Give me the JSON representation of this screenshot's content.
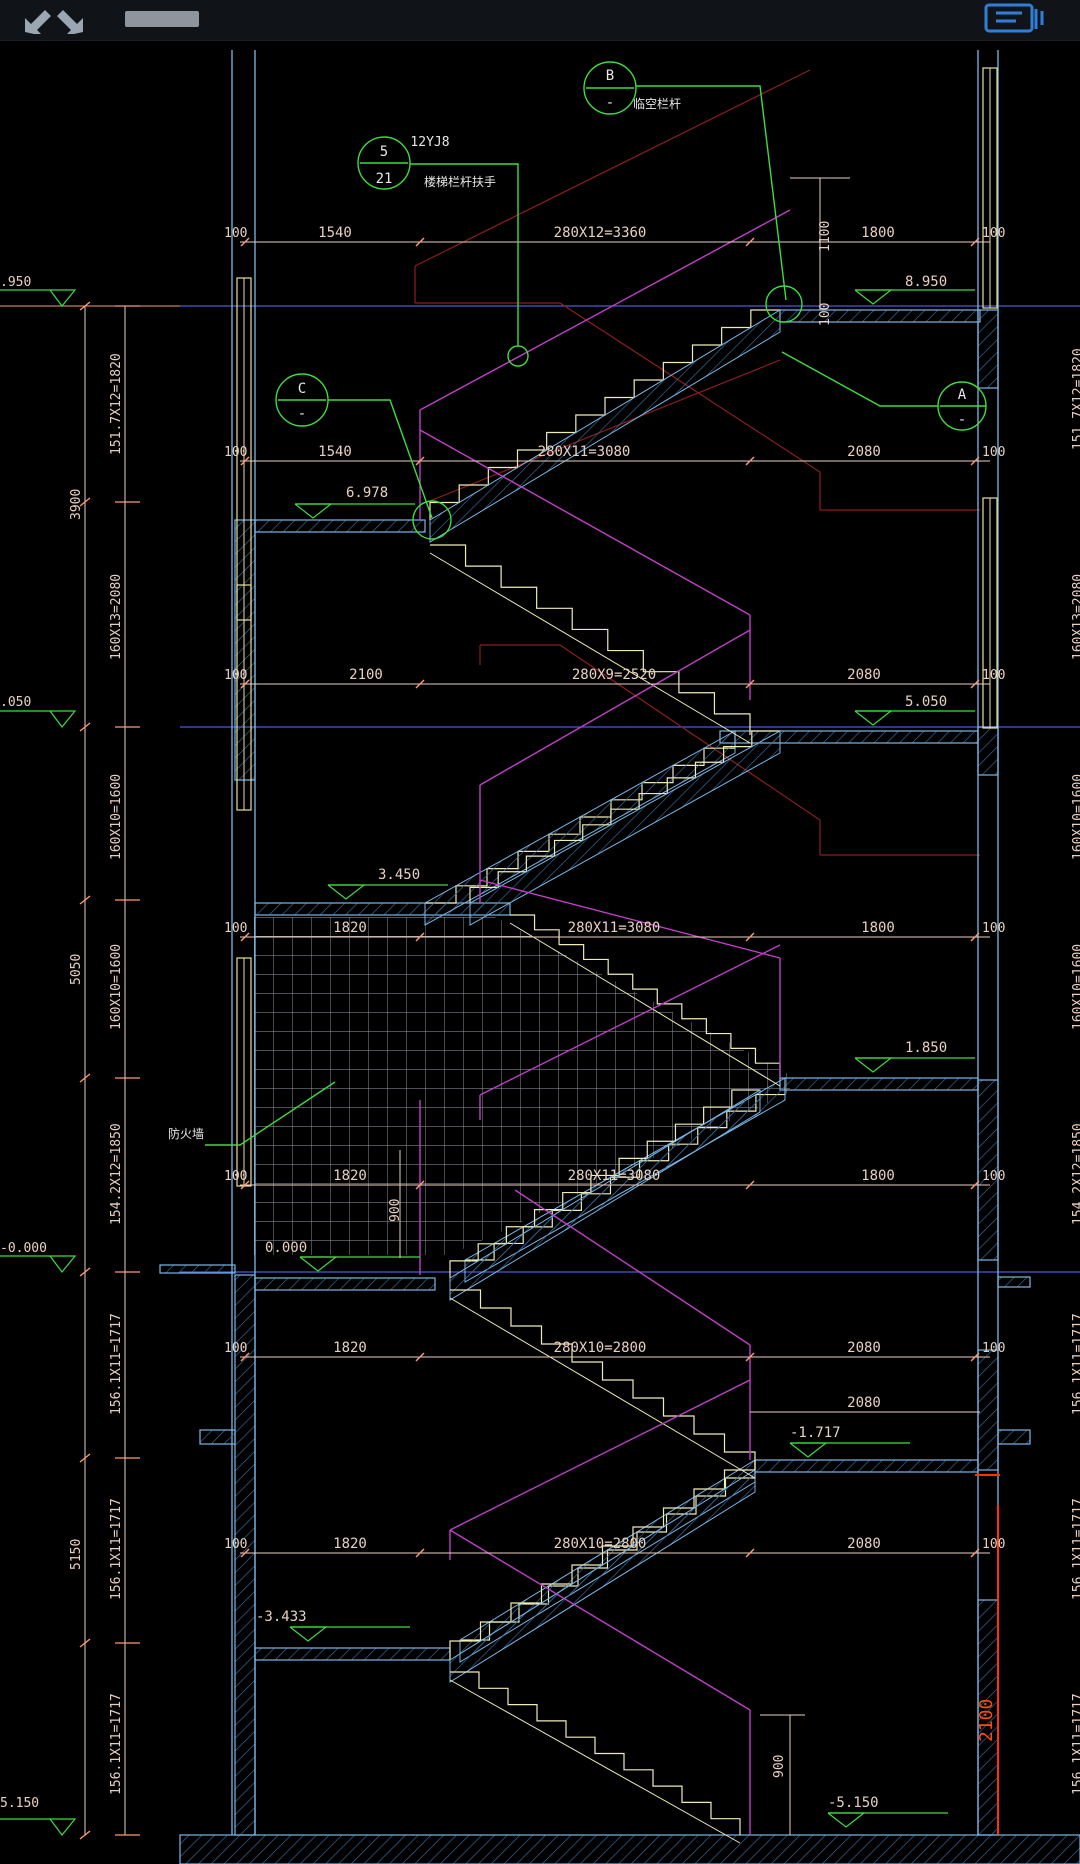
{
  "toolbar": {
    "icons": [
      "collapse-arrows-icon",
      "title-placeholder-bar",
      "layers-panel-icon"
    ]
  },
  "colors": {
    "background": "#000000",
    "wall": "#7ab8e8",
    "hatch": "#3b6d9c",
    "dimension": "#e8d0c0",
    "dim_tick": "#ff9a72",
    "axis": "#4a5ad8",
    "diagonal": "#c040c8",
    "stair": "#f0ecb8",
    "leader": "#3fdc3f",
    "hidden": "#8c1e1e",
    "window": "#e8e0a0",
    "highlight": "#ff3300"
  },
  "drawing": {
    "left_levels": [
      ".950",
      ".050",
      "-0.000",
      "5.150"
    ],
    "left_vertical_dims": [
      "3900",
      "5050",
      "5150"
    ],
    "inner_vertical_dims": [
      "151.7X12=1820",
      "160X13=2080",
      "160X10=1600",
      "160X10=1600",
      "154.2X12=1850",
      "156.1X11=1717",
      "156.1X11=1717",
      "156.1X11=1717"
    ],
    "right_edge_dims": [
      "151.7X12=1820",
      "160X13=2080",
      "160X10=1600",
      "160X10=1600",
      "154.2X12=1850",
      "156.1X11=1717",
      "156.1X11=1717",
      "156.1X11=1717"
    ],
    "dims_100": "100",
    "horizontal_dims": [
      {
        "left": "1540",
        "mid": "280X12=3360",
        "right": "1800"
      },
      {
        "left": "1540",
        "mid": "280X11=3080",
        "right": "2080"
      },
      {
        "left": "2100",
        "mid": "280X9=2520",
        "right": "2080"
      },
      {
        "left": "1820",
        "mid": "280X11=3080",
        "right": "1800"
      },
      {
        "left": "1820",
        "mid": "280X11=3080",
        "right": "1800"
      },
      {
        "left": "1820",
        "mid": "280X10=2800",
        "right": "2080"
      },
      {
        "left": "1820",
        "mid": "280X10=2800",
        "right": "2080"
      }
    ],
    "extra_dim_2080": "2080",
    "landing_levels": [
      "8.950",
      "6.978",
      "5.050",
      "3.450",
      "1.850",
      "0.000",
      "-1.717",
      "-3.433",
      "-5.150"
    ],
    "callouts": [
      {
        "top": "B",
        "bottom": "-",
        "text": "临空栏杆"
      },
      {
        "top": "5",
        "bottom": "21",
        "code": "12YJ8",
        "text": "楼梯栏杆扶手"
      },
      {
        "top": "C",
        "bottom": "-"
      },
      {
        "top": "A",
        "bottom": "-"
      }
    ],
    "dim_1100": "1100",
    "dim_100_vertical": "100",
    "dim_900": "900",
    "dim_900_bottom": "900",
    "firewall_label": "防火墙",
    "highlight_dim": "2100"
  }
}
